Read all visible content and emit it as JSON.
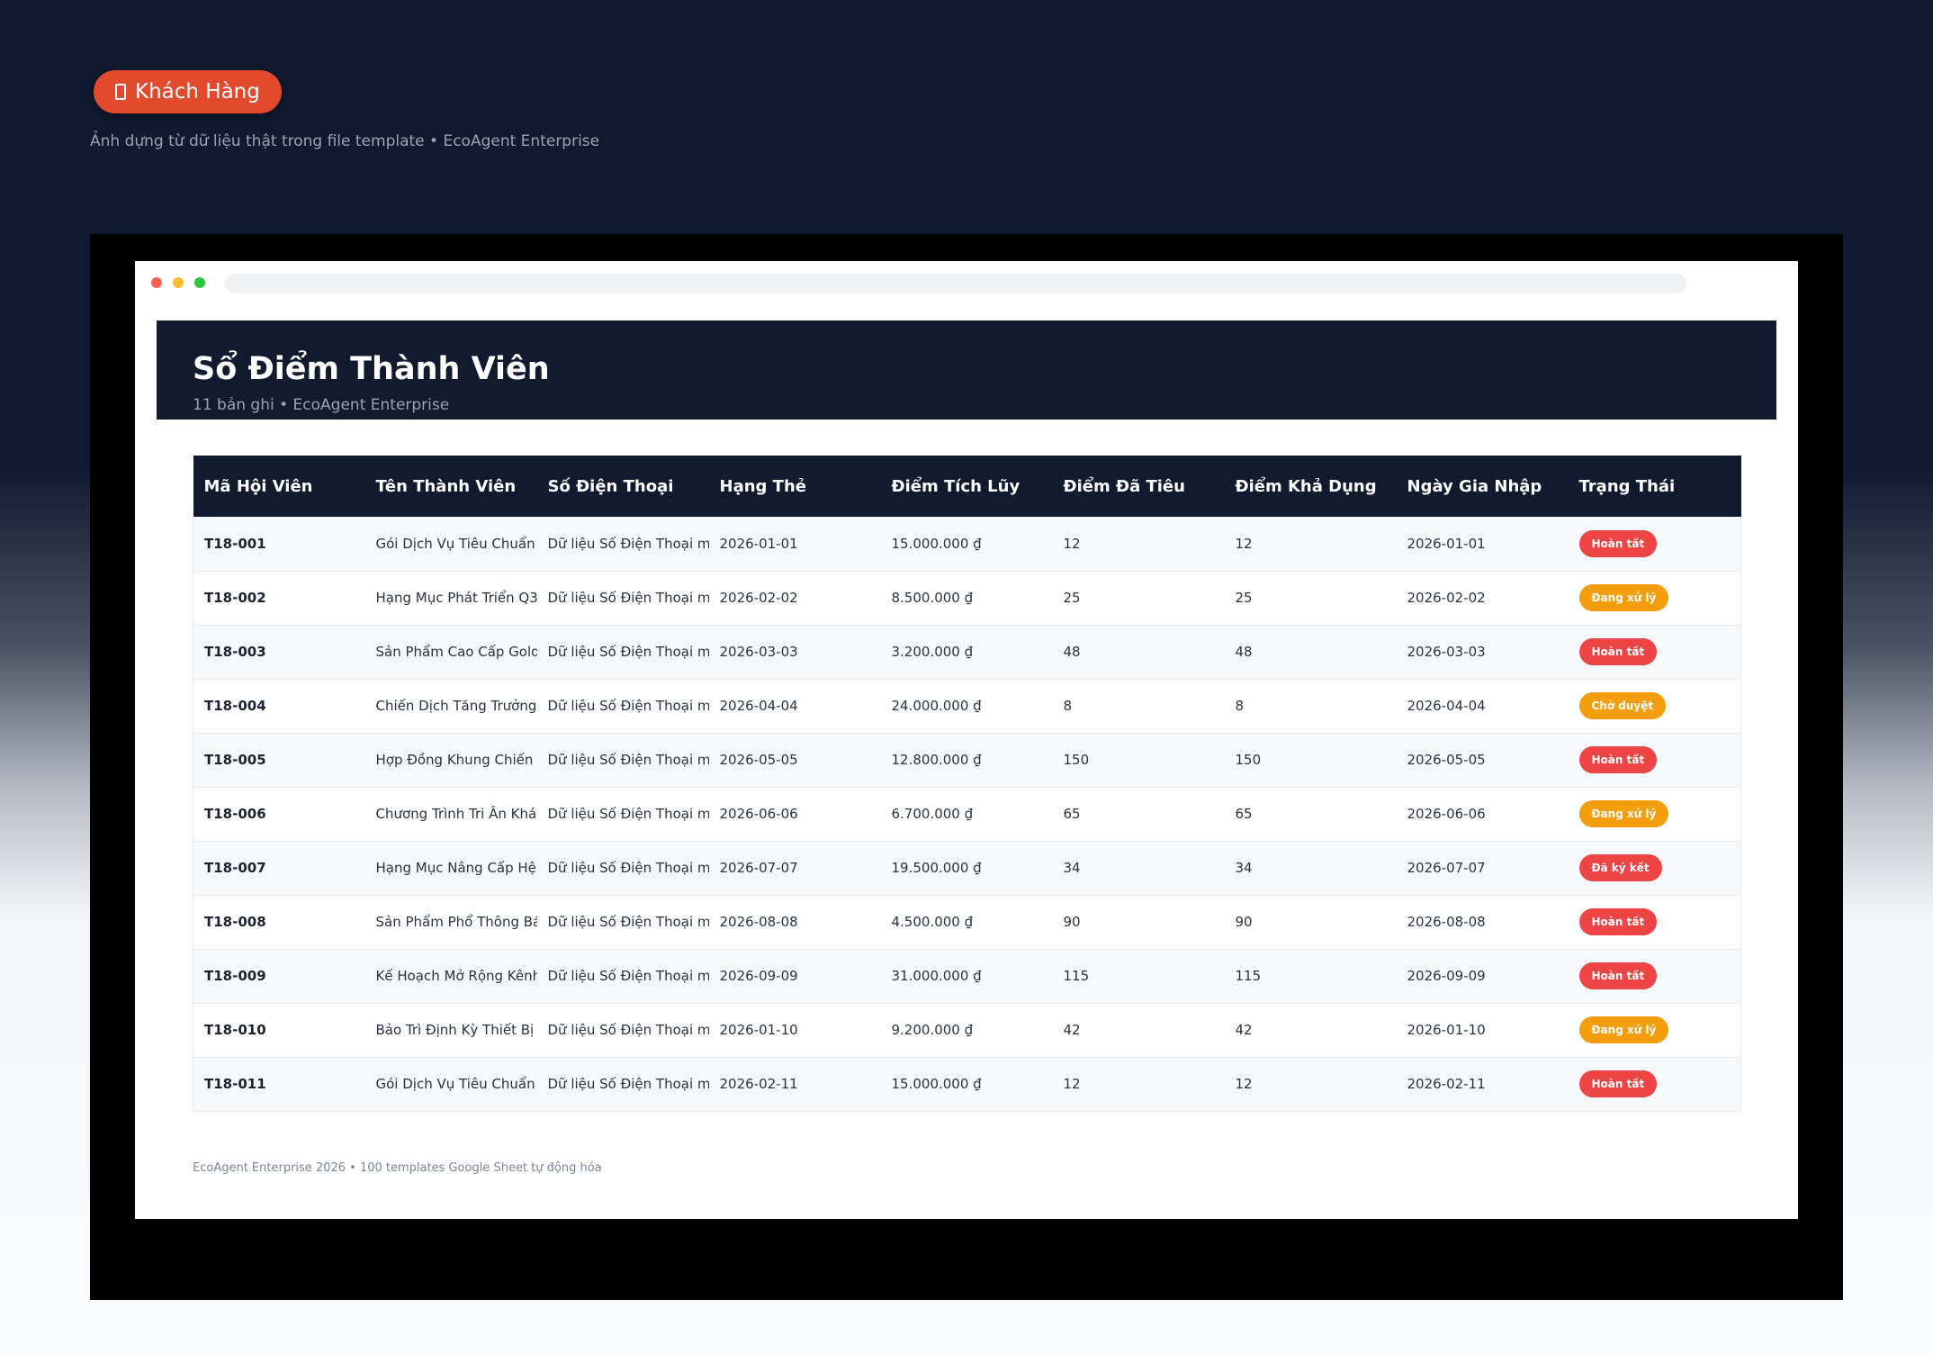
{
  "header": {
    "pill_label": "Khách Hàng",
    "subtitle": "Ảnh dựng từ dữ liệu thật trong file template • EcoAgent Enterprise"
  },
  "banner": {
    "title": "Sổ Điểm Thành Viên",
    "subtitle": "11 bản ghi • EcoAgent Enterprise"
  },
  "table": {
    "columns": [
      "Mã Hội Viên",
      "Tên Thành Viên",
      "Số Điện Thoại",
      "Hạng Thẻ",
      "Điểm Tích Lũy",
      "Điểm Đã Tiêu",
      "Điểm Khả Dụng",
      "Ngày Gia Nhập",
      "Trạng Thái"
    ],
    "rows": [
      [
        "T18-001",
        "Gói Dịch Vụ Tiêu Chuẩn",
        "Dữ liệu Số Điện Thoại mẫu",
        "2026-01-01",
        "15.000.000 ₫",
        "12",
        "12",
        "2026-01-01",
        "Hoàn tất"
      ],
      [
        "T18-002",
        "Hạng Mục Phát Triển Q3",
        "Dữ liệu Số Điện Thoại mẫu",
        "2026-02-02",
        "8.500.000 ₫",
        "25",
        "25",
        "2026-02-02",
        "Đang xử lý"
      ],
      [
        "T18-003",
        "Sản Phẩm Cao Cấp Gold",
        "Dữ liệu Số Điện Thoại mẫu",
        "2026-03-03",
        "3.200.000 ₫",
        "48",
        "48",
        "2026-03-03",
        "Hoàn tất"
      ],
      [
        "T18-004",
        "Chiến Dịch Tăng Trưởng T",
        "Dữ liệu Số Điện Thoại mẫu",
        "2026-04-04",
        "24.000.000 ₫",
        "8",
        "8",
        "2026-04-04",
        "Chờ duyệt"
      ],
      [
        "T18-005",
        "Hợp Đồng Khung Chiến Lược",
        "Dữ liệu Số Điện Thoại mẫu",
        "2026-05-05",
        "12.800.000 ₫",
        "150",
        "150",
        "2026-05-05",
        "Hoàn tất"
      ],
      [
        "T18-006",
        "Chương Trình Tri Ân Khách",
        "Dữ liệu Số Điện Thoại mẫu",
        "2026-06-06",
        "6.700.000 ₫",
        "65",
        "65",
        "2026-06-06",
        "Đang xử lý"
      ],
      [
        "T18-007",
        "Hạng Mục Nâng Cấp Hệ Thống",
        "Dữ liệu Số Điện Thoại mẫu",
        "2026-07-07",
        "19.500.000 ₫",
        "34",
        "34",
        "2026-07-07",
        "Đã ký kết"
      ],
      [
        "T18-008",
        "Sản Phẩm Phổ Thông Bán Chạy",
        "Dữ liệu Số Điện Thoại mẫu",
        "2026-08-08",
        "4.500.000 ₫",
        "90",
        "90",
        "2026-08-08",
        "Hoàn tất"
      ],
      [
        "T18-009",
        "Kế Hoạch Mở Rộng Kênh Phân Phối",
        "Dữ liệu Số Điện Thoại mẫu",
        "2026-09-09",
        "31.000.000 ₫",
        "115",
        "115",
        "2026-09-09",
        "Hoàn tất"
      ],
      [
        "T18-010",
        "Bảo Trì Định Kỳ Thiết Bị",
        "Dữ liệu Số Điện Thoại mẫu",
        "2026-01-10",
        "9.200.000 ₫",
        "42",
        "42",
        "2026-01-10",
        "Đang xử lý"
      ],
      [
        "T18-011",
        "Gói Dịch Vụ Tiêu Chuẩn",
        "Dữ liệu Số Điện Thoại mẫu",
        "2026-02-11",
        "15.000.000 ₫",
        "12",
        "12",
        "2026-02-11",
        "Hoàn tất"
      ]
    ],
    "status_colors": {
      "Hoàn tất": "#ef4444",
      "Đang xử lý": "#f59e0b",
      "Chờ duyệt": "#f59e0b",
      "Đã ký kết": "#ef4444"
    }
  },
  "footer": {
    "text": "EcoAgent Enterprise 2026 • 100 templates Google Sheet tự động hóa"
  }
}
